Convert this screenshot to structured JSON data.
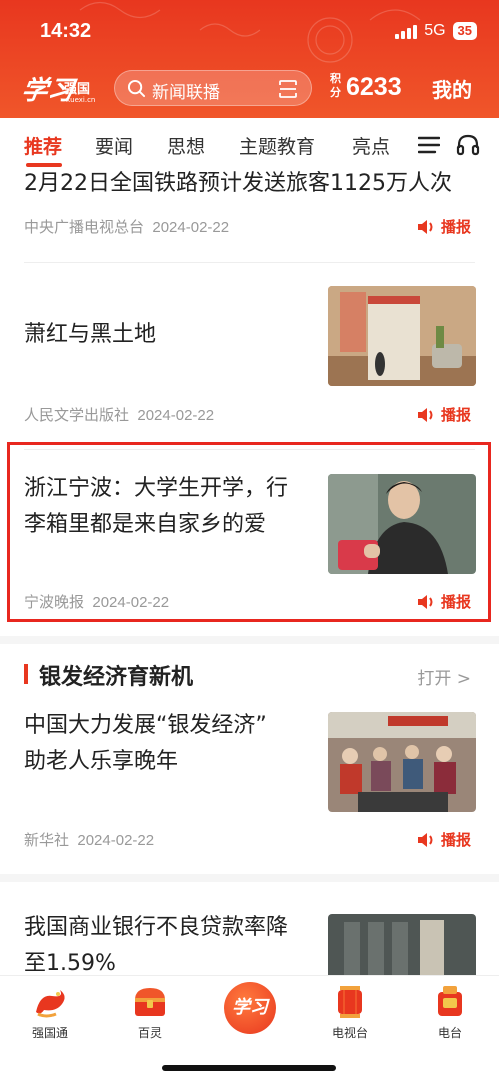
{
  "status_bar": {
    "time": "14:32",
    "network": "5G",
    "battery": "35"
  },
  "header": {
    "logo_calligraphy": "学习",
    "logo_name": "强国",
    "logo_sub": "xuexi.cn",
    "search_placeholder": "新闻联播",
    "points_label": "积分",
    "points_value": "6233",
    "mine_label": "我的"
  },
  "tabs": [
    {
      "label": "推荐",
      "active": true
    },
    {
      "label": "要闻"
    },
    {
      "label": "思想"
    },
    {
      "label": "主题教育"
    },
    {
      "label": "亮点"
    }
  ],
  "play_label": "播报",
  "articles": [
    {
      "title": "2月22日全国铁路预计发送旅客1125万人次",
      "source": "中央广播电视总台",
      "date": "2024-02-22"
    },
    {
      "title": "萧红与黑土地",
      "source": "人民文学出版社",
      "date": "2024-02-22",
      "thumb": "book-cover"
    },
    {
      "title_line1": "浙江宁波：大学生开学，行",
      "title_line2": "李箱里都是来自家乡的爱",
      "source": "宁波晚报",
      "date": "2024-02-22",
      "thumb": "student-photo",
      "highlighted": true
    }
  ],
  "section": {
    "title": "银发经济育新机",
    "open_label": "打开 >",
    "articles": [
      {
        "title_line1": "中国大力发展“银发经济”",
        "title_line2": "助老人乐享晚年",
        "source": "新华社",
        "date": "2024-02-22",
        "thumb": "elderly-photo"
      },
      {
        "title_line1": "我国商业银行不良贷款率降",
        "title_line2": "至1.59%",
        "thumb": "bank-photo"
      }
    ]
  },
  "bottom_nav": [
    {
      "label": "强国通",
      "icon": "dragon-icon"
    },
    {
      "label": "百灵",
      "icon": "treasure-box-icon"
    },
    {
      "label": "学习",
      "icon": "xuexi-center-icon"
    },
    {
      "label": "电视台",
      "icon": "lantern-icon"
    },
    {
      "label": "电台",
      "icon": "radio-icon"
    }
  ],
  "colors": {
    "accent": "#e8371f",
    "muted": "#999999",
    "highlight_border": "#e8271f"
  }
}
